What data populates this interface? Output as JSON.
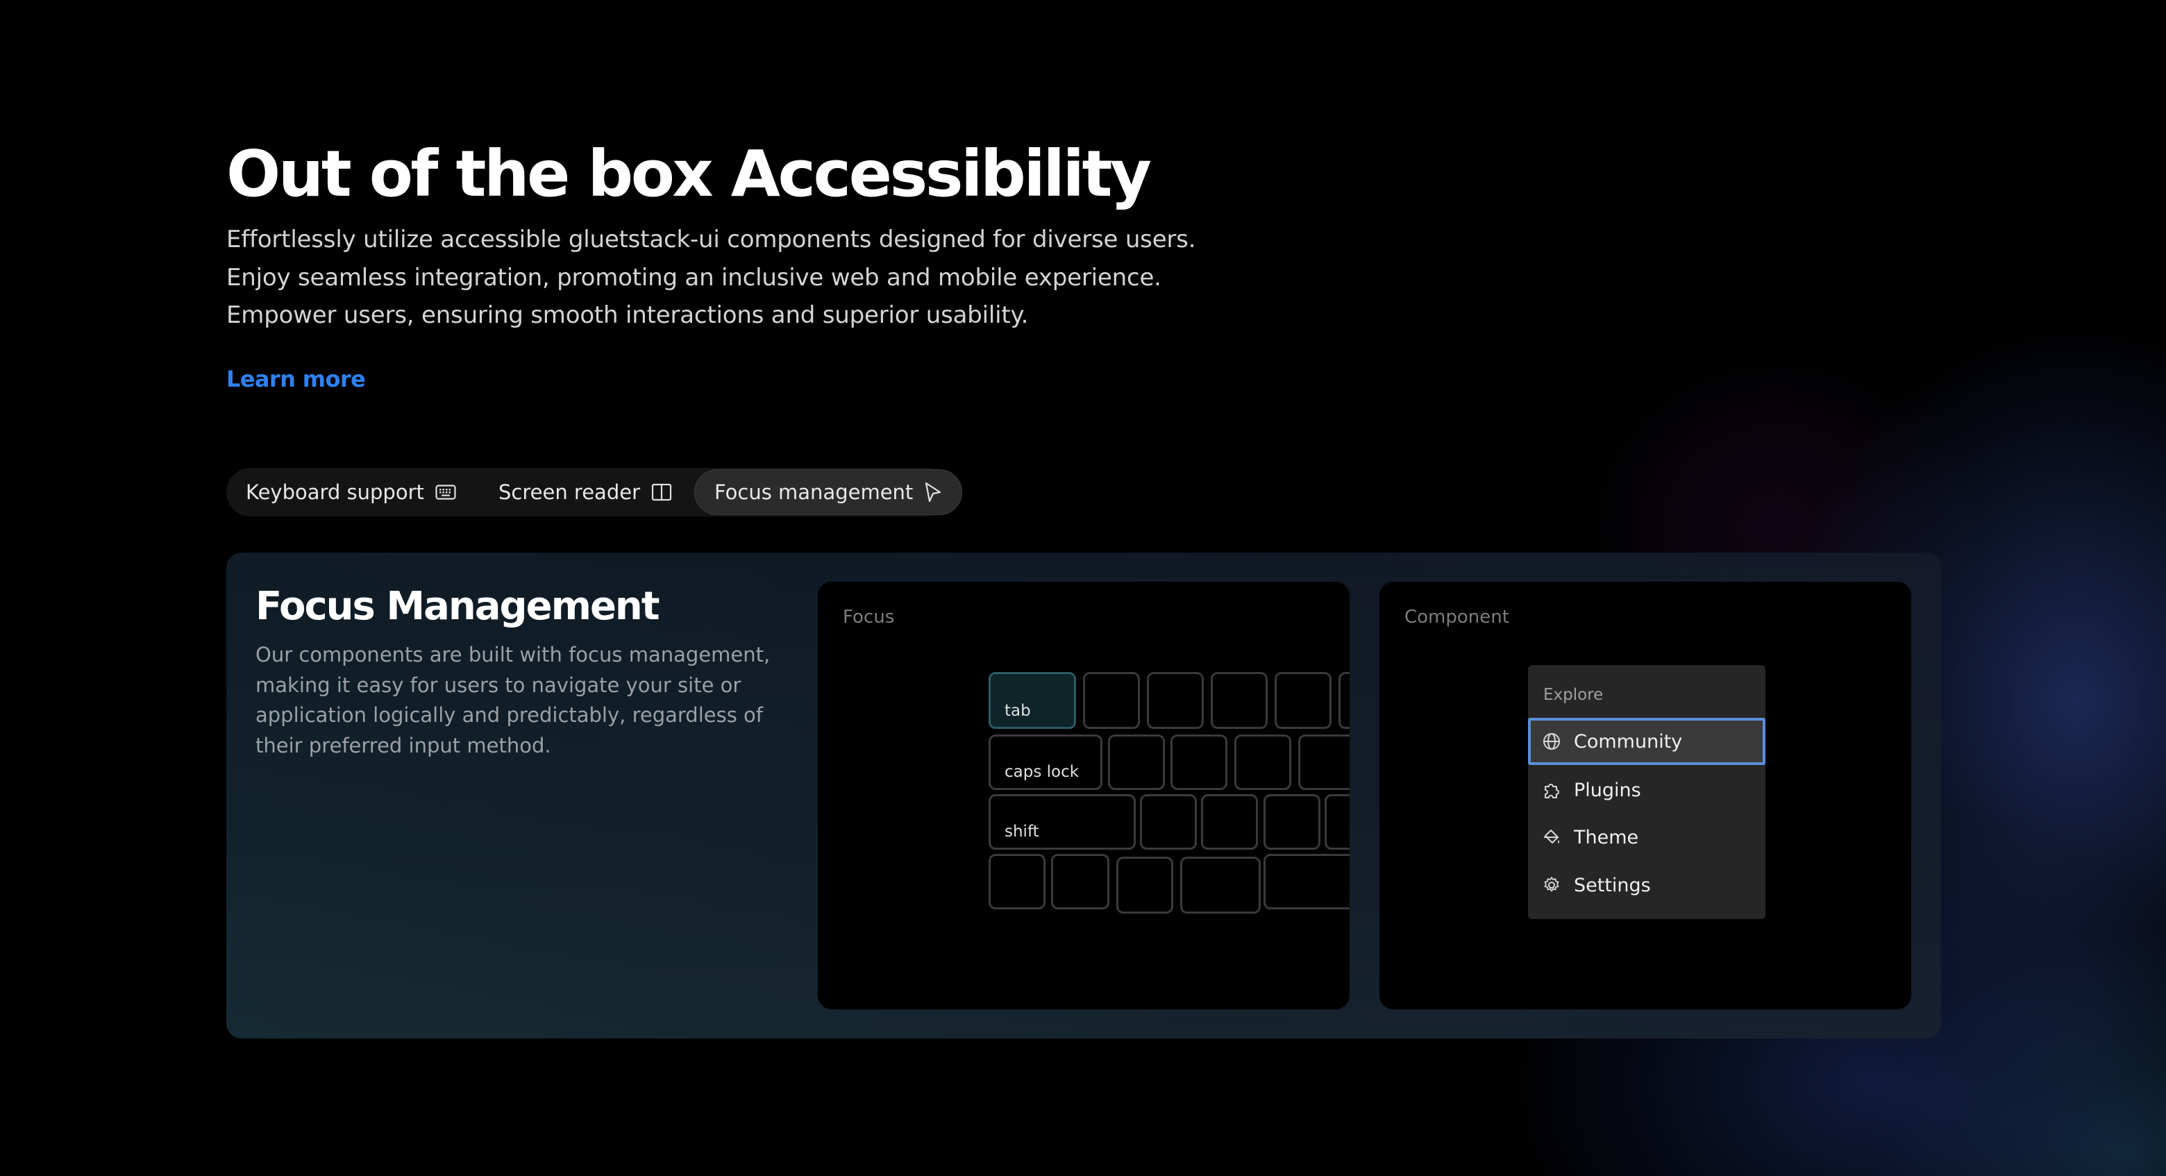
{
  "hero": {
    "title": "Out of the box Accessibility",
    "description": "Effortlessly utilize accessible gluetstack-ui components designed for diverse users. Enjoy seamless integration, promoting an inclusive web and mobile experience. Empower users, ensuring smooth interactions and superior usability.",
    "learn_more": "Learn more"
  },
  "colors": {
    "accent_link": "#2f80ed",
    "focus_ring": "#5b8fd9",
    "focused_key": "#0e2428"
  },
  "tabs": [
    {
      "label": "Keyboard support",
      "icon": "keyboard-icon",
      "active": false
    },
    {
      "label": "Screen reader",
      "icon": "book-open-icon",
      "active": false
    },
    {
      "label": "Focus management",
      "icon": "cursor-pointer-icon",
      "active": true
    }
  ],
  "card": {
    "title": "Focus Management",
    "description": "Our components are built with focus management, making it easy for users to navigate your site or application logically and predictably, regardless of their preferred input method."
  },
  "focus_panel": {
    "label": "Focus",
    "keys": {
      "tab": "tab",
      "caps_lock": "caps lock",
      "shift": "shift"
    },
    "focused_key": "tab"
  },
  "component_panel": {
    "label": "Component",
    "menu": {
      "header": "Explore",
      "items": [
        {
          "label": "Community",
          "icon": "globe-icon",
          "focused": true
        },
        {
          "label": "Plugins",
          "icon": "puzzle-icon",
          "focused": false
        },
        {
          "label": "Theme",
          "icon": "paint-bucket-icon",
          "focused": false
        },
        {
          "label": "Settings",
          "icon": "gear-icon",
          "focused": false
        }
      ]
    }
  }
}
